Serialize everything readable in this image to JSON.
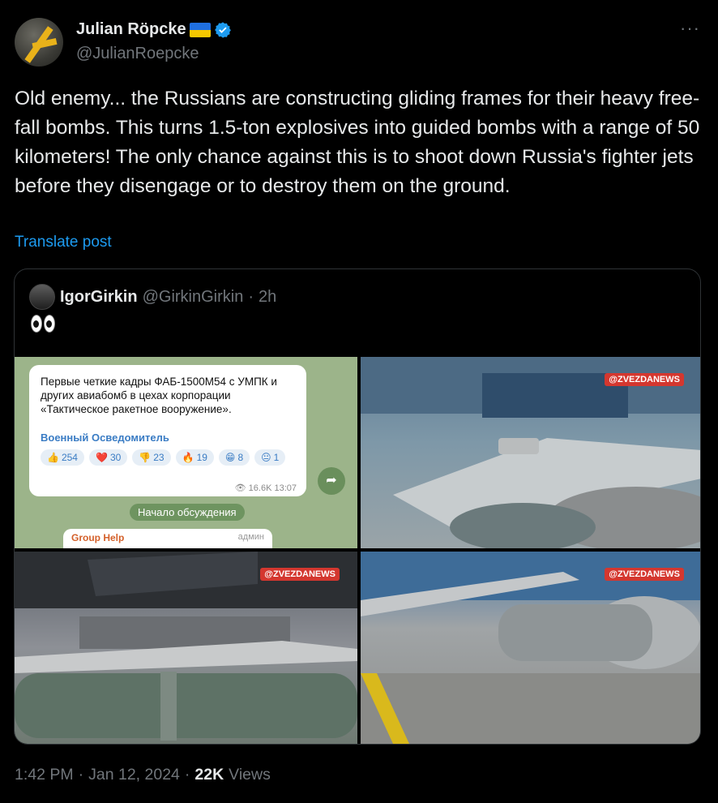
{
  "author": {
    "name": "Julian Röpcke",
    "handle": "@JulianRoepcke",
    "verified": true
  },
  "tweet": {
    "text": "Old enemy... the Russians are constructing gliding frames for their heavy free-fall bombs. This turns 1.5-ton explosives into guided bombs with a range of 50 kilometers! The only chance against this is to shoot down Russia's fighter jets before they disengage or to destroy them on the ground.",
    "translate_label": "Translate post"
  },
  "quoted": {
    "name": "IgorGirkin",
    "handle": "@GirkinGirkin",
    "separator": "·",
    "time": "2h",
    "emoji_icon": "eyes-icon",
    "media": {
      "telegram": {
        "text": "Первые четкие кадры ФАБ-1500М54 с УМПК и других авиабомб в цехах корпорации «Тактическое ракетное вооружение».",
        "channel": "Военный Осведомитель",
        "reactions": [
          {
            "icon": "👍",
            "count": "254"
          },
          {
            "icon": "❤️",
            "count": "30"
          },
          {
            "icon": "👎",
            "count": "23"
          },
          {
            "icon": "🔥",
            "count": "19"
          },
          {
            "icon": "😁",
            "count": "8"
          },
          {
            "icon": "😐",
            "count": "1"
          }
        ],
        "views": "16.6K",
        "time": "13:07",
        "discussion_label": "Начало обсуждения",
        "group_name": "Group Help",
        "group_role": "админ"
      },
      "watermark": "@ZVEZDANEWS"
    }
  },
  "footer": {
    "time": "1:42 PM",
    "dot": "·",
    "date": "Jan 12, 2024",
    "views_count": "22K",
    "views_label": "Views"
  },
  "colors": {
    "accent": "#1d9bf0",
    "background": "#000000",
    "muted": "#71767b"
  }
}
